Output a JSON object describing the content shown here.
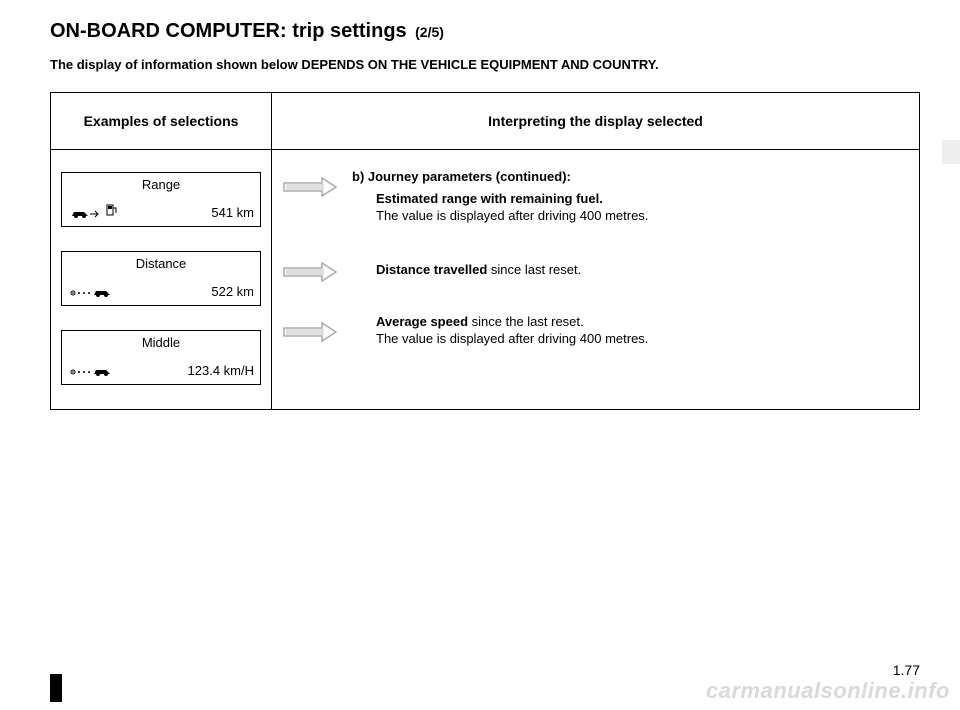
{
  "title": {
    "main": "ON-BOARD COMPUTER: trip settings",
    "sub": "(2/5)"
  },
  "notice": "The display of information shown below DEPENDS ON THE VEHICLE EQUIPMENT AND COUNTRY.",
  "table": {
    "headers": {
      "col1": "Examples of selections",
      "col2": "Interpreting the display selected"
    },
    "displays": [
      {
        "title": "Range",
        "value": "541 km"
      },
      {
        "title": "Distance",
        "value": "522 km"
      },
      {
        "title": "Middle",
        "value": "123.4 km/H"
      }
    ],
    "descriptions": {
      "section_heading": "b) Journey parameters (continued):",
      "row1": {
        "strong": "Estimated range with remaining fuel.",
        "rest": "The value is displayed after driving 400 metres."
      },
      "row2": {
        "strong": "Distance travelled",
        "rest": " since last reset."
      },
      "row3": {
        "strong": "Average speed",
        "rest": " since the last reset.",
        "line2": "The value is displayed after driving 400 metres."
      }
    }
  },
  "page_number": "1.77",
  "watermark": "carmanualsonline.info"
}
